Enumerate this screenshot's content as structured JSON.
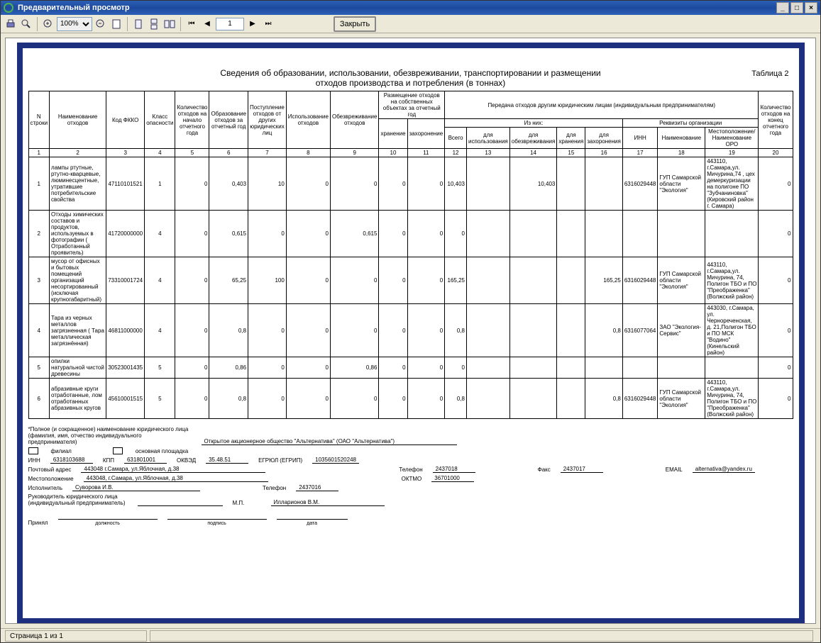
{
  "window": {
    "title": "Предварительный просмотр"
  },
  "toolbar": {
    "zoom_value": "100%",
    "page_value": "1",
    "close_label": "Закрыть"
  },
  "status": {
    "page_text": "Страница 1 из 1"
  },
  "report": {
    "title_line1": "Сведения об образовании, использовании, обезвреживании, транспортировании и размещении",
    "title_line2": "отходов производства и потребления (в тоннах)",
    "table_label": "Таблица 2"
  },
  "headers": {
    "c1": "N строки",
    "c2": "Наименование отходов",
    "c3": "Код ФККО",
    "c4": "Класс опасности",
    "c5": "Количество отходов на начало отчетного года",
    "c6": "Образование отходов за отчетный год",
    "c7": "Поступление отходов от других юридических лиц",
    "c8": "Использование отходов",
    "c9": "Обезвреживание отходов",
    "g10": "Размещение отходов на собственных объектах за отчетный год",
    "c10a": "хранение",
    "c11a": "захоронение",
    "g12": "Передача отходов другим юридическим лицам (индивидуальным предпринимателям)",
    "g12a": "Из них:",
    "g12b": "Реквизиты организации",
    "c12": "Всего",
    "c13": "для использования",
    "c14": "для обезвреживания",
    "c15": "для хранения",
    "c16": "для захоронения",
    "c17": "ИНН",
    "c18": "Наименование",
    "c19": "Местоположение/ Наименование ОРО",
    "c20": "Количество отходов на конец отчетного года",
    "n1": "1",
    "n2": "2",
    "n3": "3",
    "n4": "4",
    "n5": "5",
    "n6": "6",
    "n7": "7",
    "n8": "8",
    "n9": "9",
    "n10": "10",
    "n11": "11",
    "n12": "12",
    "n13": "13",
    "n14": "14",
    "n15": "15",
    "n16": "16",
    "n17": "17",
    "n18": "18",
    "n19": "19",
    "n20": "20"
  },
  "rows": [
    {
      "n": "1",
      "name": "лампы ртутные, ртутно-кварцевые, люминесцентные, утратившие потребительские свойства",
      "code": "47110101521",
      "cls": "1",
      "c5": "0",
      "c6": "0,403",
      "c7": "10",
      "c8": "0",
      "c9": "0",
      "c10": "0",
      "c11": "0",
      "c12": "10,403",
      "c13": "",
      "c14": "10,403",
      "c15": "",
      "c16": "",
      "inn": "6316029448",
      "org": "ГУП Самарской области \"Экология\"",
      "loc": "443110, г.Самара,ул. Мичурина,74 , цех демеркуризации на полигоне ПО \"Зубчаниновка\" (Кировский район г. Самара)",
      "c20": "0"
    },
    {
      "n": "2",
      "name": "Отходы химических составов и продуктов, используемых в фотографии ( Отработанный проявитель)",
      "code": "41720000000",
      "cls": "4",
      "c5": "0",
      "c6": "0,615",
      "c7": "0",
      "c8": "0",
      "c9": "0,615",
      "c10": "0",
      "c11": "0",
      "c12": "0",
      "c13": "",
      "c14": "",
      "c15": "",
      "c16": "",
      "inn": "",
      "org": "",
      "loc": "",
      "c20": "0"
    },
    {
      "n": "3",
      "name": "мусор от офисных и бытовых помещений организаций несортированный (исключая крупногабаритный)",
      "code": "73310001724",
      "cls": "4",
      "c5": "0",
      "c6": "65,25",
      "c7": "100",
      "c8": "0",
      "c9": "0",
      "c10": "0",
      "c11": "0",
      "c12": "165,25",
      "c13": "",
      "c14": "",
      "c15": "",
      "c16": "165,25",
      "inn": "6316029448",
      "org": "ГУП Самарской области \"Экология\"",
      "loc": "443110, г.Самара,ул. Мичурина, 74, Полигон ТБО и ПО \"Преображенка\"(Волжский район)",
      "c20": "0"
    },
    {
      "n": "4",
      "name": "Тара из черных металлов загрязненная ( Тара металлическая загрязнённая)",
      "code": "46811000000",
      "cls": "4",
      "c5": "0",
      "c6": "0,8",
      "c7": "0",
      "c8": "0",
      "c9": "0",
      "c10": "0",
      "c11": "0",
      "c12": "0,8",
      "c13": "",
      "c14": "",
      "c15": "",
      "c16": "0,8",
      "inn": "6316077064",
      "org": "ЗАО \"Экология-Сервис\"",
      "loc": "443030, г.Самара, ул. Чернореченская, д. 21,Полигон ТБО и ПО МСК \"Водино\" (Кинельский район)",
      "c20": "0"
    },
    {
      "n": "5",
      "name": "опилки натуральной чистой древесины",
      "code": "30523001435",
      "cls": "5",
      "c5": "0",
      "c6": "0,86",
      "c7": "0",
      "c8": "0",
      "c9": "0,86",
      "c10": "0",
      "c11": "0",
      "c12": "0",
      "c13": "",
      "c14": "",
      "c15": "",
      "c16": "",
      "inn": "",
      "org": "",
      "loc": "",
      "c20": "0"
    },
    {
      "n": "6",
      "name": "абразивные круги отработанные, лом отработанных абразивных кругов",
      "code": "45610001515",
      "cls": "5",
      "c5": "0",
      "c6": "0,8",
      "c7": "0",
      "c8": "0",
      "c9": "0",
      "c10": "0",
      "c11": "0",
      "c12": "0,8",
      "c13": "",
      "c14": "",
      "c15": "",
      "c16": "0,8",
      "inn": "6316029448",
      "org": "ГУП Самарской области \"Экология\"",
      "loc": "443110, г.Самара,ул. Мичурина, 74, Полигон ТБО и ПО \"Преображенка\"(Волжский район)",
      "c20": "0"
    }
  ],
  "footer": {
    "note_line1": "*Полное (и сокращенное) наименование юридического лица",
    "note_line2": "(фамилия, имя, отчество индивидуального предпринимателя)",
    "company": "Открытое акционерное общество \"Альтернатива\" (ОАО \"Альтернатива\")",
    "filial_lbl": "филиал",
    "area_lbl": "основная площадка",
    "inn_lbl": "ИНН",
    "inn_val": "6318103688",
    "kpp_lbl": "КПП",
    "kpp_val": "631801001",
    "okved_lbl": "ОКВЭД",
    "okved_val": "35.48.51",
    "egrul_lbl": "ЕГРЮЛ (ЕГРИП)",
    "egrul_val": "1035601520248",
    "addr_lbl": "Почтовый адрес",
    "addr_val": "443048   г.Самара, ул.Яблочная, д.38",
    "tel_lbl": "Телефон",
    "tel_val": "2437018",
    "fax_lbl": "Факс",
    "fax_val": "2437017",
    "email_lbl": "EMAIL",
    "email_val": "alternativa@yandex.ru",
    "loc_lbl": "Местоположение",
    "loc_val": "443048, г.Самара, ул.Яблочная, д.38",
    "oktmo_lbl": "ОКТМО",
    "oktmo_val": "36701000",
    "exec_lbl": "Исполнитель",
    "exec_val": "Суворова И.В.",
    "exec_tel_lbl": "Телефон",
    "exec_tel_val": "2437016",
    "head_lbl": "Руководитель юридического лица (индивидуальный предприниматель)",
    "head_val": "Илларионов В.М.",
    "mp_lbl": "М.П.",
    "accept_lbl": "Принял",
    "post_lbl": "должность",
    "sign_lbl": "подпись",
    "date_lbl": "дата"
  }
}
